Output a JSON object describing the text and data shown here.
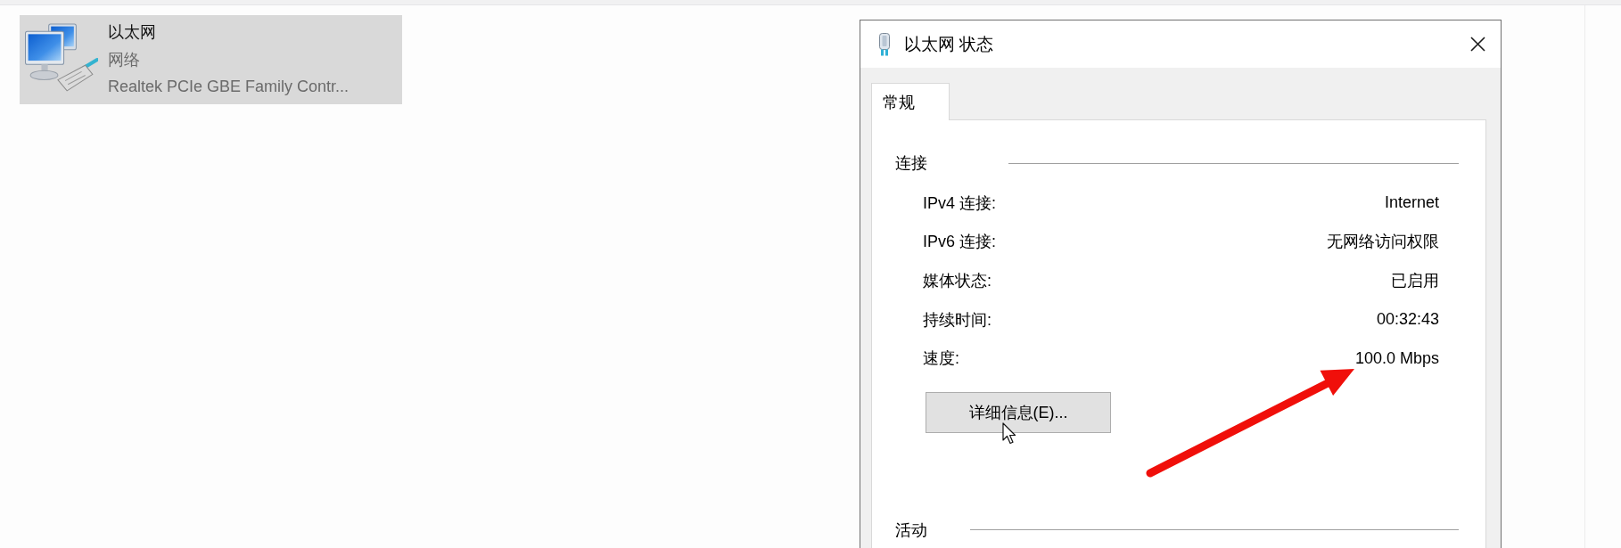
{
  "adapter": {
    "name": "以太网",
    "network": "网络",
    "device": "Realtek PCIe GBE Family Contr...",
    "selected": true
  },
  "dialog": {
    "title": "以太网 状态",
    "tabs": [
      {
        "label": "常规",
        "selected": true
      }
    ],
    "sections": [
      {
        "title": "连接",
        "rows": [
          {
            "label": "IPv4 连接:",
            "value": "Internet"
          },
          {
            "label": "IPv6 连接:",
            "value": "无网络访问权限"
          },
          {
            "label": "媒体状态:",
            "value": "已启用"
          },
          {
            "label": "持续时间:",
            "value": "00:32:43"
          },
          {
            "label": "速度:",
            "value": "100.0 Mbps"
          }
        ],
        "button": "详细信息(E)..."
      },
      {
        "title": "活动"
      }
    ]
  }
}
